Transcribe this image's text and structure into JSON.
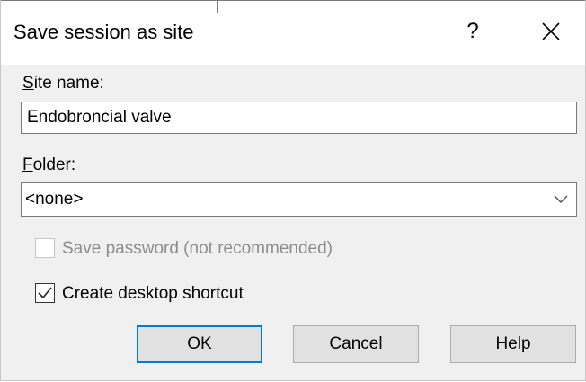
{
  "dialog": {
    "title": "Save session as site",
    "help_glyph": "?"
  },
  "site_name": {
    "label_accel": "S",
    "label_rest": "ite name:",
    "value": "Endobroncial valve"
  },
  "folder": {
    "label_accel": "F",
    "label_rest": "older:",
    "selected": "<none>"
  },
  "options": {
    "save_password": {
      "label": "Save password (not recommended)",
      "checked": false,
      "enabled": false
    },
    "desktop_shortcut": {
      "label": "Create desktop shortcut",
      "checked": true,
      "enabled": true
    }
  },
  "buttons": {
    "ok": "OK",
    "cancel": "Cancel",
    "help": "Help"
  },
  "colors": {
    "accent": "#0078d7",
    "dialog_bg": "#f0f0f0",
    "button_bg": "#e1e1e1",
    "disabled_text": "#8d8d8d"
  },
  "icons": {
    "help": "help-icon",
    "close": "close-icon",
    "dropdown": "chevron-down-icon",
    "check": "checkmark-icon"
  }
}
